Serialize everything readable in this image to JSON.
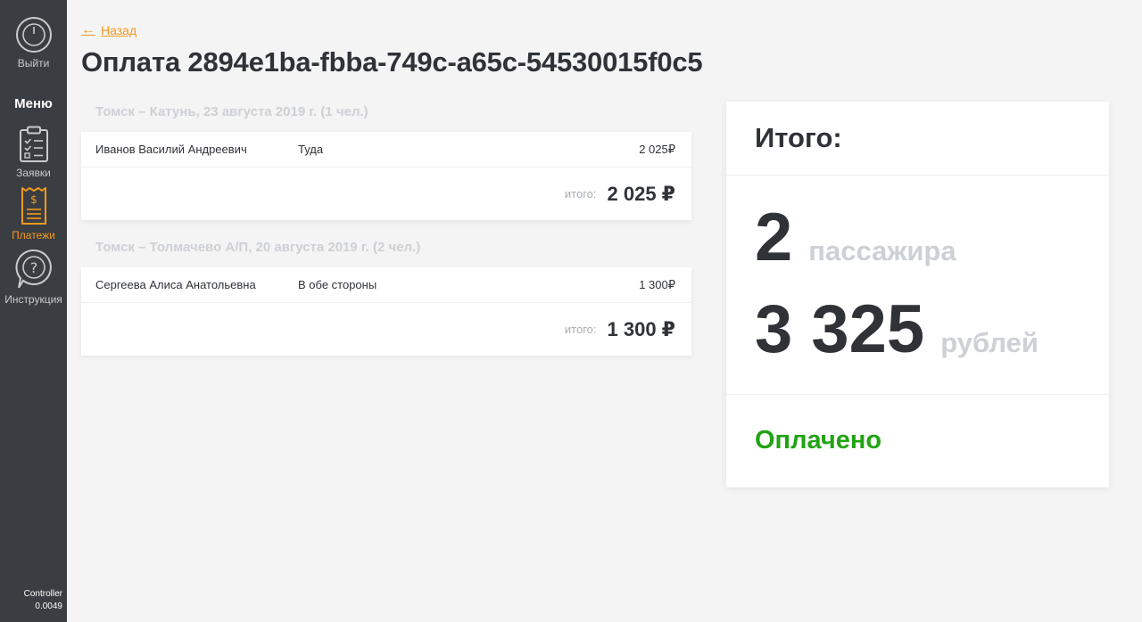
{
  "sidebar": {
    "logout_label": "Выйти",
    "menu_title": "Меню",
    "items": [
      {
        "label": "Заявки",
        "icon": "clipboard-icon",
        "active": false
      },
      {
        "label": "Платежи",
        "icon": "receipt-icon",
        "active": true
      },
      {
        "label": "Инструкция",
        "icon": "help-icon",
        "active": false
      }
    ],
    "version_line1": "Controller",
    "version_line2": "0.0049"
  },
  "header": {
    "back_label": "Назад",
    "title": "Оплата 2894e1ba-fbba-749c-a65c-54530015f0c5"
  },
  "trips": [
    {
      "title": "Томск – Катунь, 23 августа 2019 г. (1 чел.)",
      "passengers": [
        {
          "name": "Иванов Василий Андреевич",
          "direction": "Туда",
          "price": "2 025₽"
        }
      ],
      "total_label": "итого:",
      "total_value": "2 025 ₽"
    },
    {
      "title": "Томск – Толмачево А/П, 20 августа 2019 г. (2 чел.)",
      "passengers": [
        {
          "name": "Сергеева Алиса Анатольевна",
          "direction": "В обе стороны",
          "price": "1 300₽"
        }
      ],
      "total_label": "итого:",
      "total_value": "1 300 ₽"
    }
  ],
  "summary": {
    "title": "Итого:",
    "passengers_count": "2",
    "passengers_unit": "пассажира",
    "amount": "3 325",
    "amount_unit": "рублей",
    "status": "Оплачено"
  },
  "colors": {
    "sidebar_bg": "#3a3d42",
    "accent": "#f39a1c",
    "status_paid": "#23a314",
    "muted": "#cdd0d4"
  }
}
